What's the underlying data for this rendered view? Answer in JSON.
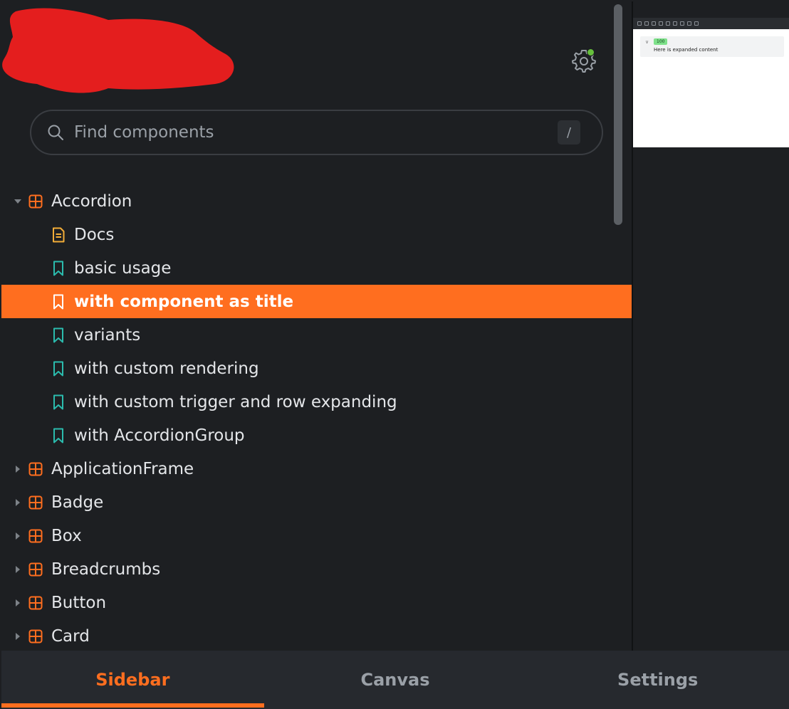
{
  "search": {
    "placeholder": "Find components",
    "shortcut": "/"
  },
  "colors": {
    "accent": "#ff6e1f",
    "leaf_icon": "#2bbbad",
    "docs_icon": "#f3ad38",
    "status_dot": "#66bf3c"
  },
  "tree": {
    "accordion": {
      "label": "Accordion",
      "icon": "component-grid-icon",
      "expanded": true,
      "children": [
        {
          "label": "Docs",
          "icon": "document-icon"
        },
        {
          "label": "basic usage",
          "icon": "bookmark-icon"
        },
        {
          "label": "with component as title",
          "icon": "bookmark-icon",
          "selected": true
        },
        {
          "label": "variants",
          "icon": "bookmark-icon"
        },
        {
          "label": "with custom rendering",
          "icon": "bookmark-icon"
        },
        {
          "label": "with custom trigger and row expanding",
          "icon": "bookmark-icon"
        },
        {
          "label": "with AccordionGroup",
          "icon": "bookmark-icon"
        }
      ]
    },
    "components": [
      {
        "label": "ApplicationFrame"
      },
      {
        "label": "Badge"
      },
      {
        "label": "Box"
      },
      {
        "label": "Breadcrumbs"
      },
      {
        "label": "Button"
      },
      {
        "label": "Card"
      }
    ]
  },
  "preview": {
    "badge": "100",
    "content": "Here is expanded content"
  },
  "tabs": [
    {
      "label": "Sidebar",
      "active": true
    },
    {
      "label": "Canvas"
    },
    {
      "label": "Settings"
    }
  ]
}
